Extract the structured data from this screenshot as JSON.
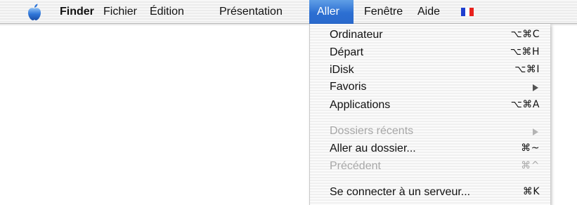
{
  "menubar": {
    "apple_icon": "apple-logo-icon",
    "finder": "Finder",
    "fichier": "Fichier",
    "edition": "Édition",
    "presentation": "Présentation",
    "aller": "Aller",
    "fenetre": "Fenêtre",
    "aide": "Aide",
    "flag_icon": "french-flag-icon",
    "flag_colors": [
      "#1f3fcf",
      "#ffffff",
      "#e8211d"
    ],
    "active_menu_color": "#2c6fd2"
  },
  "aller_menu": {
    "items": [
      {
        "label": "Ordinateur",
        "shortcut": "⌥⌘C",
        "enabled": true
      },
      {
        "label": "Départ",
        "shortcut": "⌥⌘H",
        "enabled": true
      },
      {
        "label": "iDisk",
        "shortcut": "⌥⌘I",
        "enabled": true
      },
      {
        "label": "Favoris",
        "submenu": true,
        "enabled": true
      },
      {
        "label": "Applications",
        "shortcut": "⌥⌘A",
        "enabled": true
      },
      {
        "label": "Dossiers récents",
        "submenu": true,
        "enabled": false
      },
      {
        "label": "Aller au dossier...",
        "shortcut": "⌘~",
        "enabled": true
      },
      {
        "label": "Précédent",
        "shortcut": "⌘^",
        "enabled": false
      },
      {
        "label": "Se connecter à un serveur...",
        "shortcut": "⌘K",
        "enabled": true
      }
    ]
  }
}
